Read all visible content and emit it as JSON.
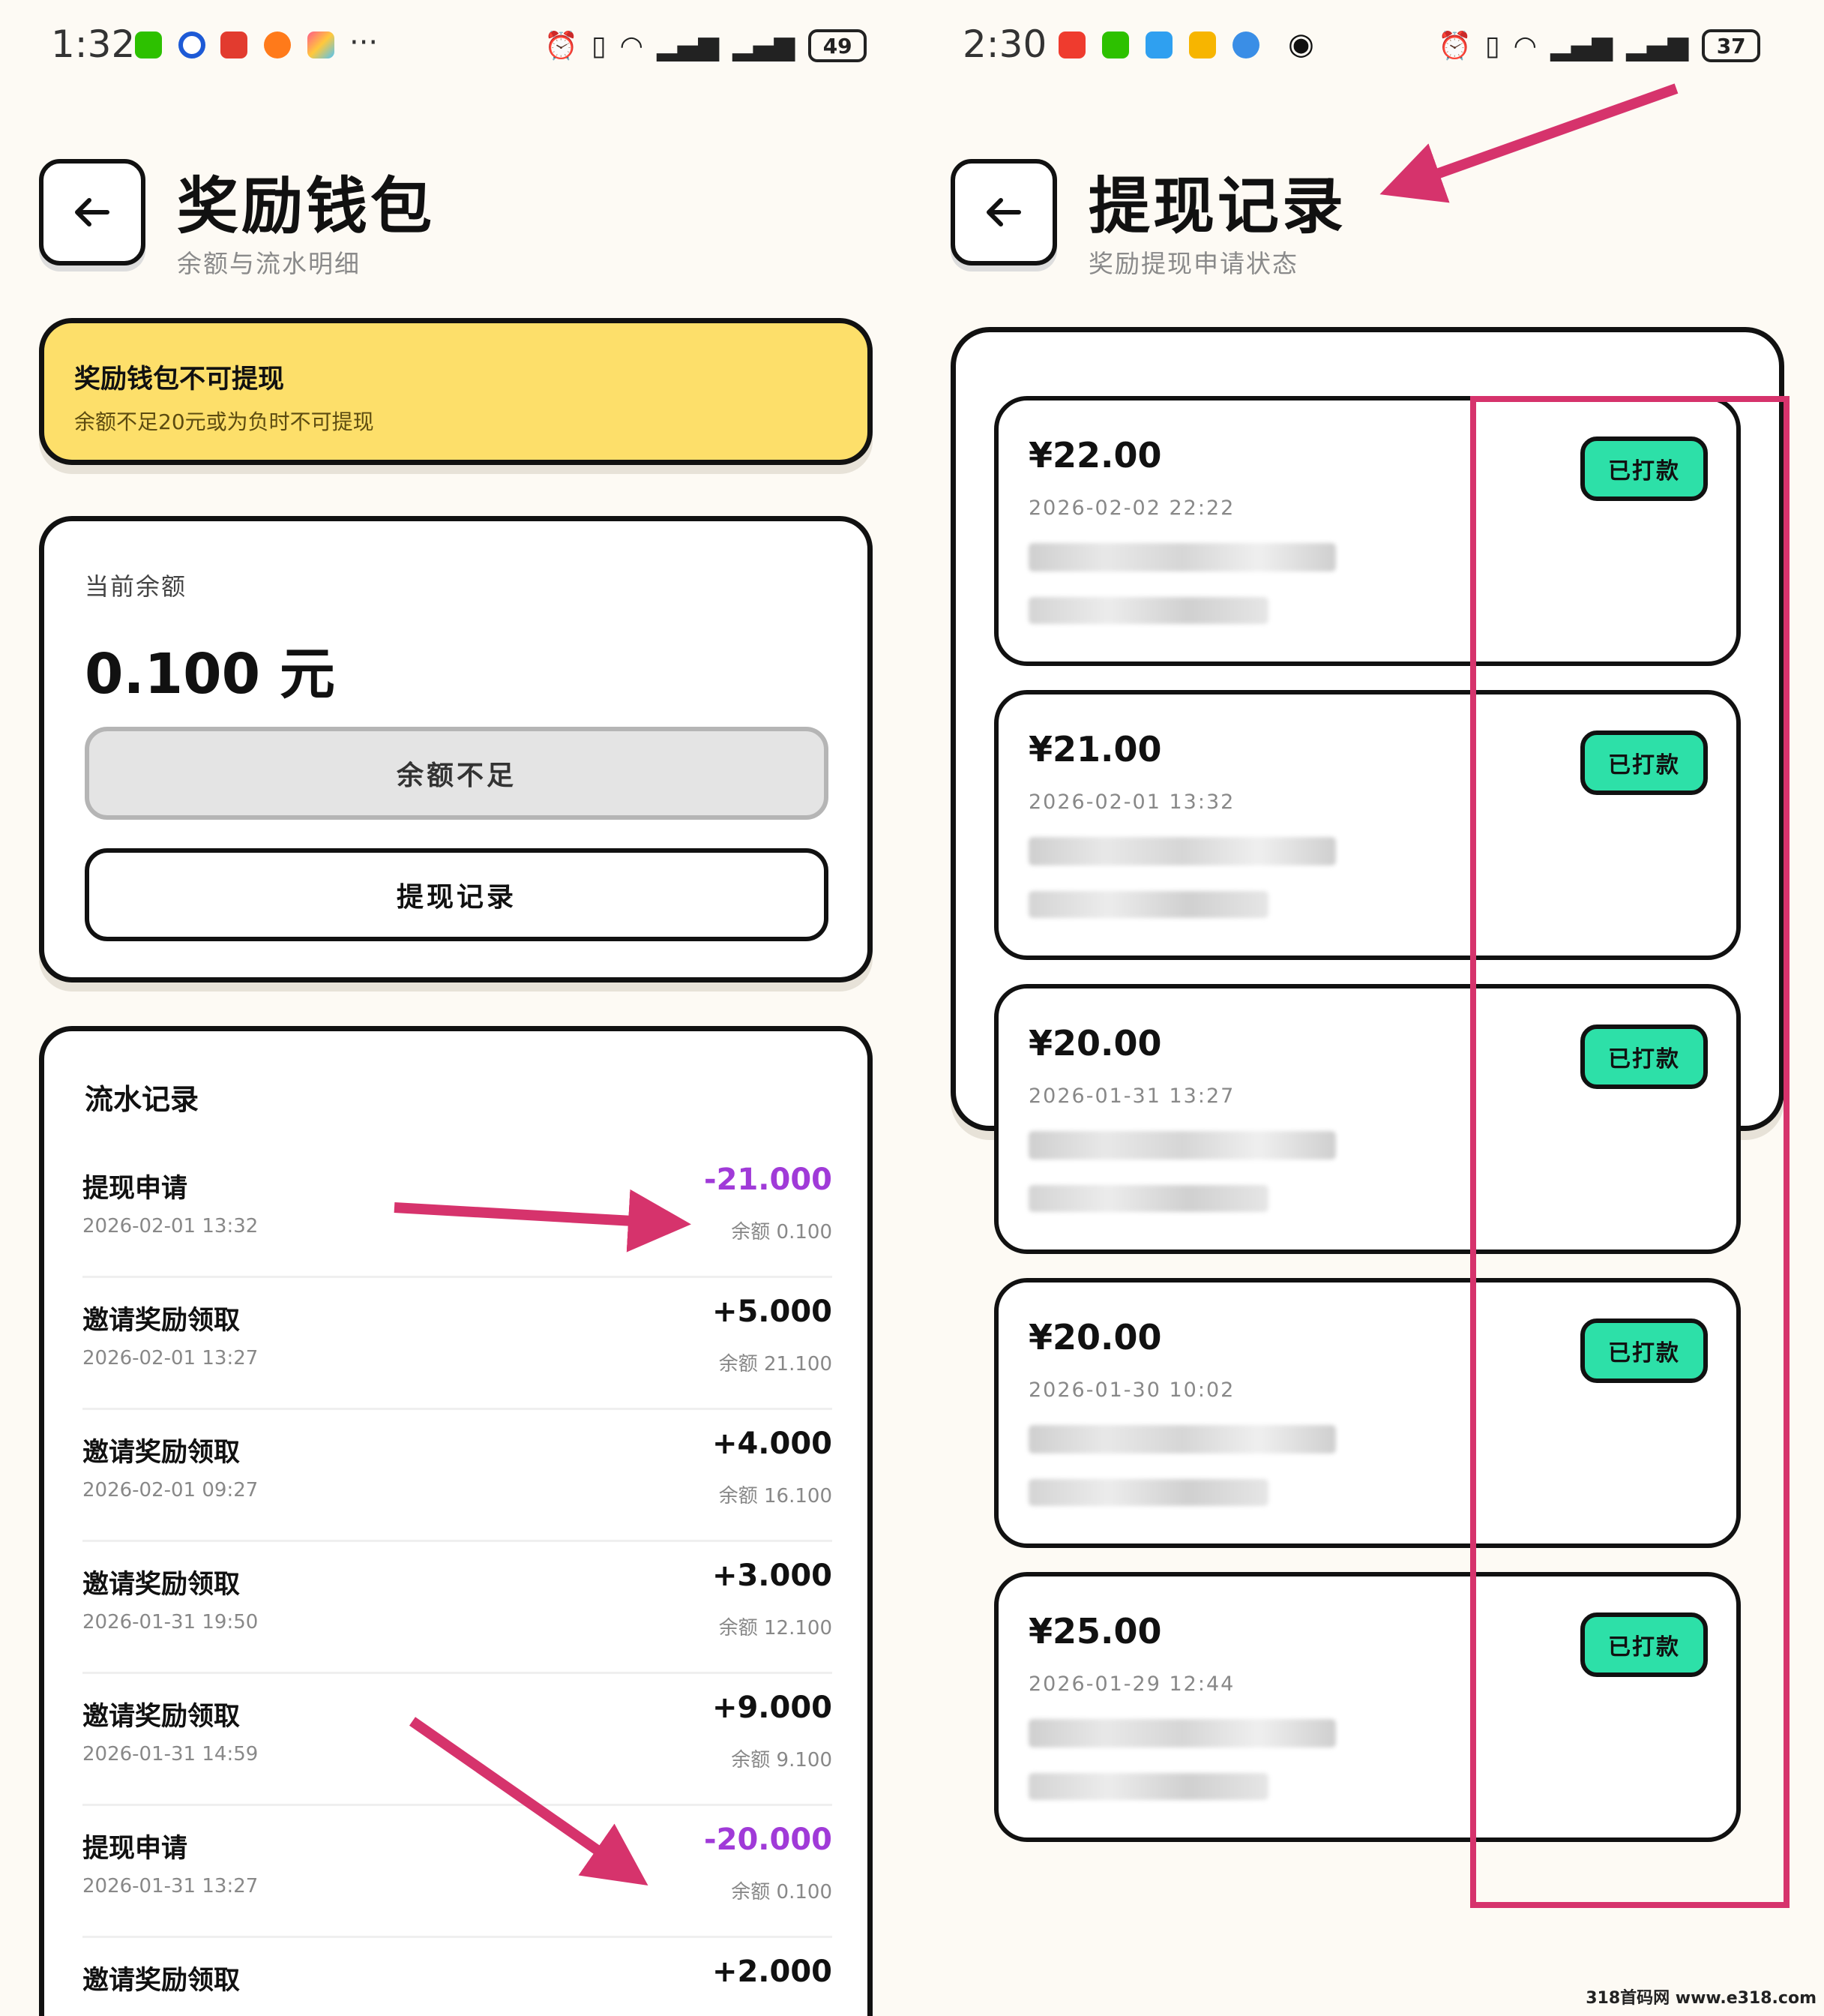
{
  "left": {
    "status": {
      "time": "1:32",
      "battery": "49"
    },
    "header": {
      "title": "奖励钱包",
      "subtitle": "余额与流水明细"
    },
    "notice": {
      "title": "奖励钱包不可提现",
      "text": "余额不足20元或为负时不可提现"
    },
    "balance": {
      "label": "当前余额",
      "value": "0.100 元",
      "insufficient_button": "余额不足",
      "records_button": "提现记录"
    },
    "flow": {
      "title": "流水记录",
      "items": [
        {
          "title": "提现申请",
          "date": "2026-02-01 13:32",
          "amount": "-21.000",
          "balance": "余额 0.100",
          "negative": true
        },
        {
          "title": "邀请奖励领取",
          "date": "2026-02-01 13:27",
          "amount": "+5.000",
          "balance": "余额 21.100",
          "negative": false
        },
        {
          "title": "邀请奖励领取",
          "date": "2026-02-01 09:27",
          "amount": "+4.000",
          "balance": "余额 16.100",
          "negative": false
        },
        {
          "title": "邀请奖励领取",
          "date": "2026-01-31 19:50",
          "amount": "+3.000",
          "balance": "余额 12.100",
          "negative": false
        },
        {
          "title": "邀请奖励领取",
          "date": "2026-01-31 14:59",
          "amount": "+9.000",
          "balance": "余额 9.100",
          "negative": false
        },
        {
          "title": "提现申请",
          "date": "2026-01-31 13:27",
          "amount": "-20.000",
          "balance": "余额 0.100",
          "negative": true
        },
        {
          "title": "邀请奖励领取",
          "date": "",
          "amount": "+2.000",
          "balance": "",
          "negative": false
        }
      ]
    }
  },
  "right": {
    "status": {
      "time": "2:30",
      "battery": "37"
    },
    "header": {
      "title": "提现记录",
      "subtitle": "奖励提现申请状态"
    },
    "withdrawals": [
      {
        "amount": "¥22.00",
        "date": "2026-02-02 22:22",
        "status": "已打款"
      },
      {
        "amount": "¥21.00",
        "date": "2026-02-01 13:32",
        "status": "已打款"
      },
      {
        "amount": "¥20.00",
        "date": "2026-01-31 13:27",
        "status": "已打款"
      },
      {
        "amount": "¥20.00",
        "date": "2026-01-30 10:02",
        "status": "已打款"
      },
      {
        "amount": "¥25.00",
        "date": "2026-01-29 12:44",
        "status": "已打款"
      }
    ]
  },
  "watermark": "318首码网 www.e318.com",
  "colors": {
    "accent_pink": "#d6336c",
    "paid_green": "#2de0a8",
    "notice_yellow": "#fddf6a",
    "negative_purple": "#a03ad8"
  }
}
